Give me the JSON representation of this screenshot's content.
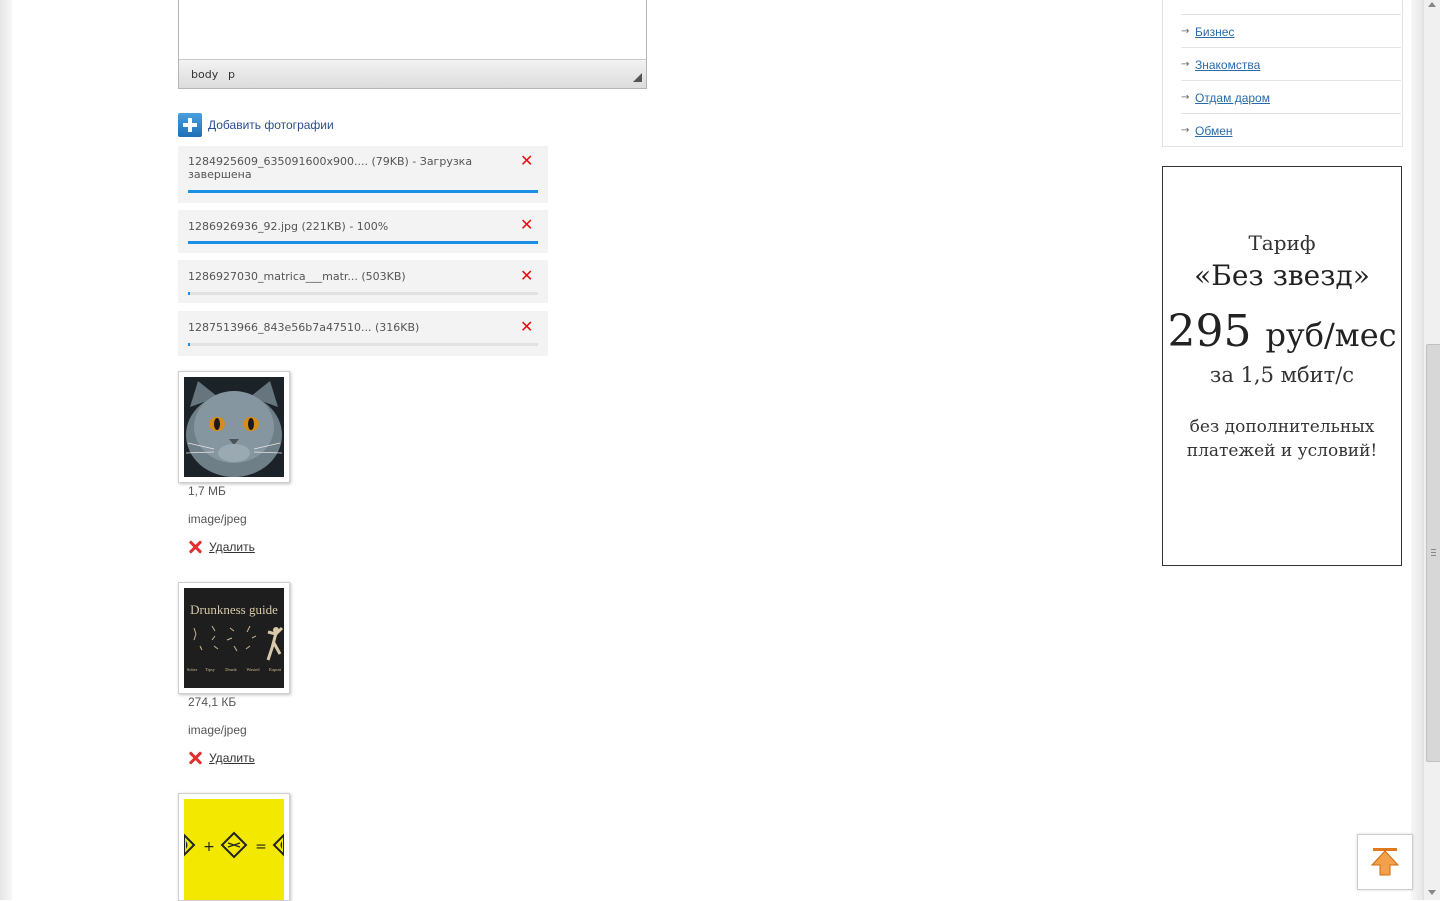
{
  "editor": {
    "path": [
      "body",
      "p"
    ]
  },
  "add_photos": {
    "label": "Добавить фотографии"
  },
  "uploads": [
    {
      "text": "1284925609_635091600x900.... (79KB) - Загрузка завершена",
      "progress": 1.0
    },
    {
      "text": "1286926936_92.jpg (221KB) - 100%",
      "progress": 1.0
    },
    {
      "text": "1286927030_matrica___matr... (503KB)",
      "progress": 0.005
    },
    {
      "text": "1287513966_843e56b7a47510... (316KB)",
      "progress": 0.005
    }
  ],
  "upload_remove_symbol": "✕",
  "photos": [
    {
      "size": "1,7 МБ",
      "type": "image/jpeg",
      "delete_label": "Удалить",
      "image": "cat-photo"
    },
    {
      "size": "274,1 КБ",
      "type": "image/jpeg",
      "delete_label": "Удалить",
      "image": "drunkness-guide",
      "image_title": "Drunkness guide",
      "image_labels": [
        "Sober",
        "Tipsy",
        "Drunk",
        "Wasted",
        "Kaputt"
      ]
    },
    {
      "image": "yellow-sign-equation",
      "image_symbols": [
        "+",
        "="
      ]
    }
  ],
  "menu": {
    "items": [
      "Бизнес",
      "Знакомства",
      "Отдам даром",
      "Обмен"
    ]
  },
  "ad": {
    "line1": "Тариф",
    "line2": "«Без звезд»",
    "price": "295",
    "price_unit": "руб/мес",
    "speed": "за 1,5 мбит/с",
    "note": "без дополнительных платежей и условий!"
  },
  "colors": {
    "progress": "#1a8fe3",
    "remove": "#dd1111",
    "link": "#2a6aa8",
    "ad_border": "#333333",
    "to_top_arrow": "#f08a2a"
  }
}
